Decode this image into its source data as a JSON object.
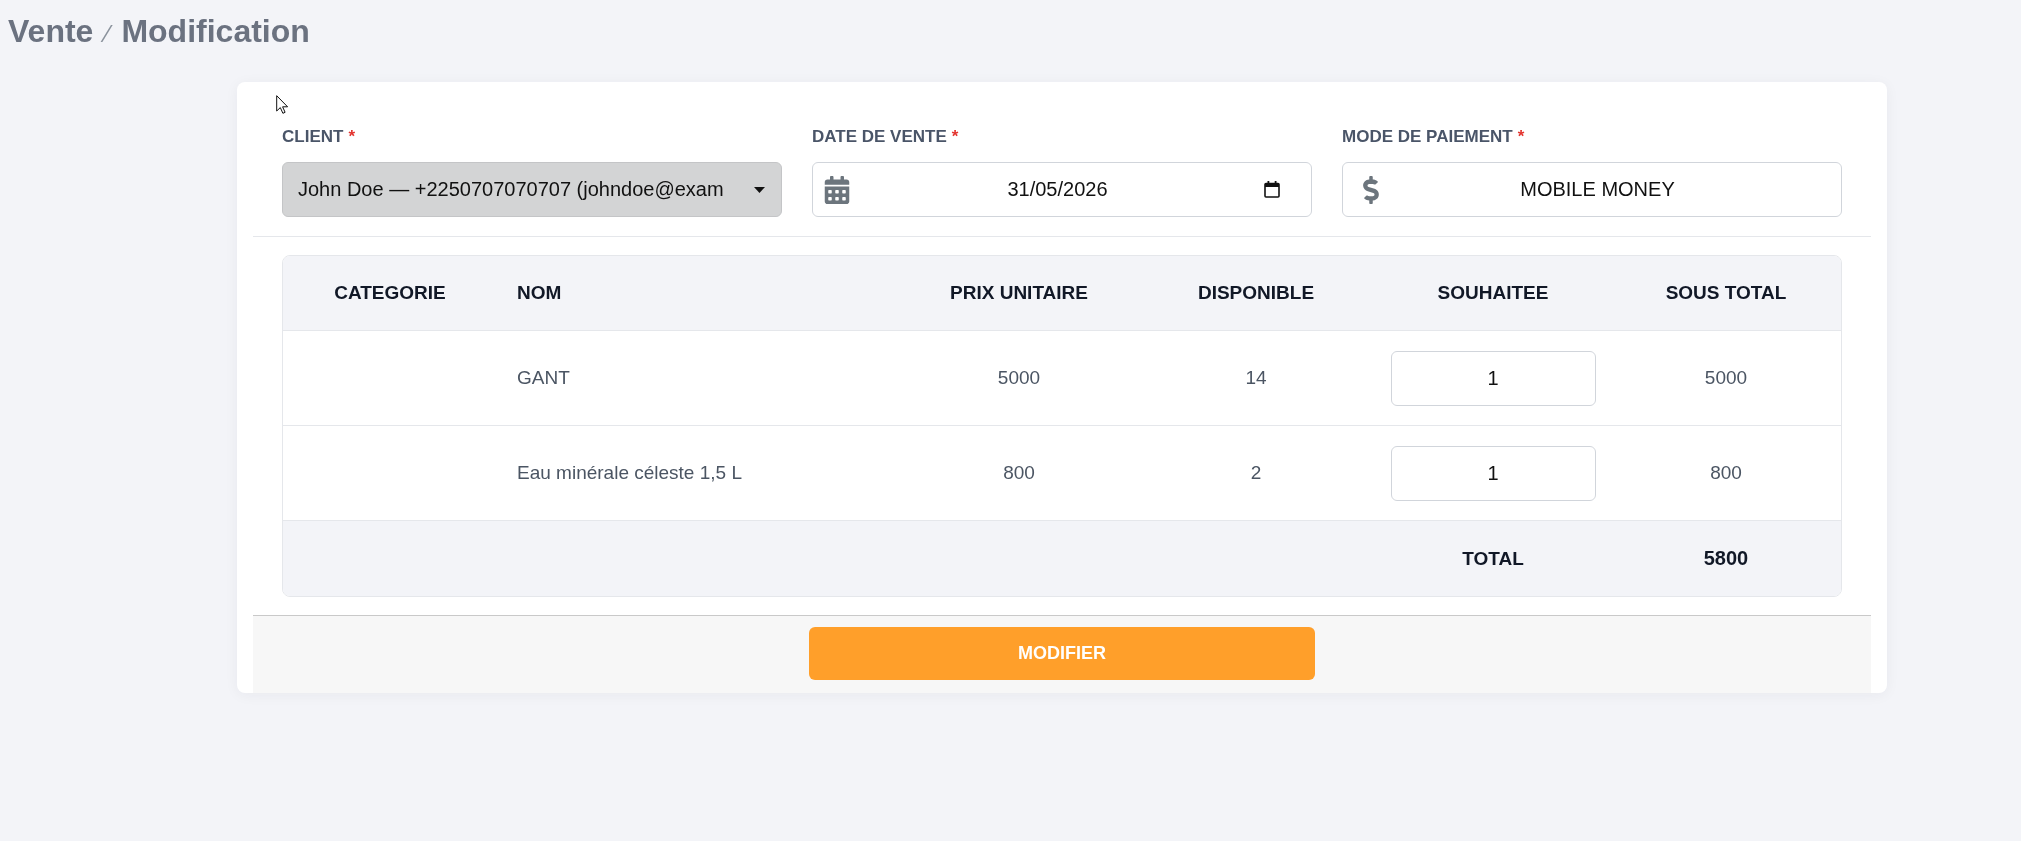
{
  "breadcrumb": {
    "items": [
      "Vente",
      "Modification"
    ],
    "separator": "⁄"
  },
  "form": {
    "fields": [
      {
        "kind": "select",
        "label": "CLIENT",
        "required_mark": "*",
        "value": "John Doe — +2250707070707 (johndoe@exam"
      },
      {
        "kind": "date",
        "label": "DATE DE VENTE",
        "required_mark": "*",
        "value": "31/05/2026"
      },
      {
        "kind": "payment",
        "label": "MODE DE PAIEMENT",
        "required_mark": "*",
        "value": "MOBILE MONEY"
      }
    ]
  },
  "table": {
    "columns": [
      "CATEGORIE",
      "NOM",
      "PRIX UNITAIRE",
      "DISPONIBLE",
      "SOUHAITEE",
      "SOUS TOTAL"
    ],
    "rows": [
      {
        "nom": "GANT",
        "prix_unitaire": "5000",
        "disponible": "14",
        "souhaitee": "1",
        "sous_total": "5000"
      },
      {
        "nom": "Eau minérale céleste 1,5 L",
        "prix_unitaire": "800",
        "disponible": "2",
        "souhaitee": "1",
        "sous_total": "800"
      }
    ],
    "footer": {
      "label": "TOTAL",
      "value": "5800"
    }
  },
  "submit_button": "MODIFIER"
}
